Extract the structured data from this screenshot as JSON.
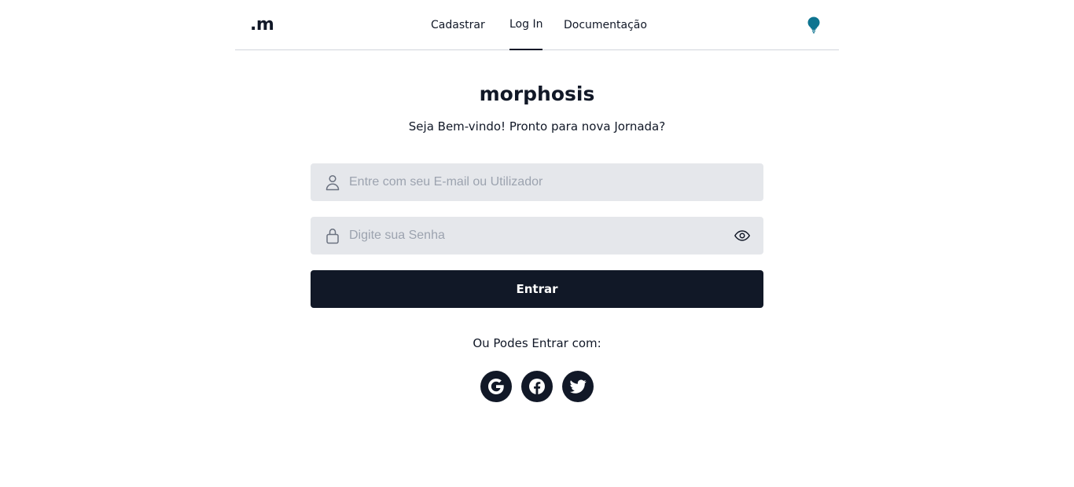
{
  "header": {
    "logo": ".m",
    "nav": [
      {
        "label": "Cadastrar"
      },
      {
        "label": "Log In",
        "active": true
      },
      {
        "label": "Documentação"
      }
    ],
    "theme_icon": "lightbulb-icon",
    "theme_icon_color": "#0e7490"
  },
  "main": {
    "brand": "morphosis",
    "tagline": "Seja Bem-vindo! Pronto para nova Jornada?",
    "email_placeholder": "Entre com seu E-mail ou Utilizador",
    "password_placeholder": "Digite sua Senha",
    "submit_label": "Entrar",
    "alt_login_label": "Ou Podes Entrar com:",
    "social": [
      {
        "icon": "google-icon"
      },
      {
        "icon": "facebook-icon"
      },
      {
        "icon": "twitter-icon"
      }
    ]
  },
  "colors": {
    "primary": "#111827",
    "input_bg": "#e5e7eb",
    "accent": "#0e7490"
  }
}
